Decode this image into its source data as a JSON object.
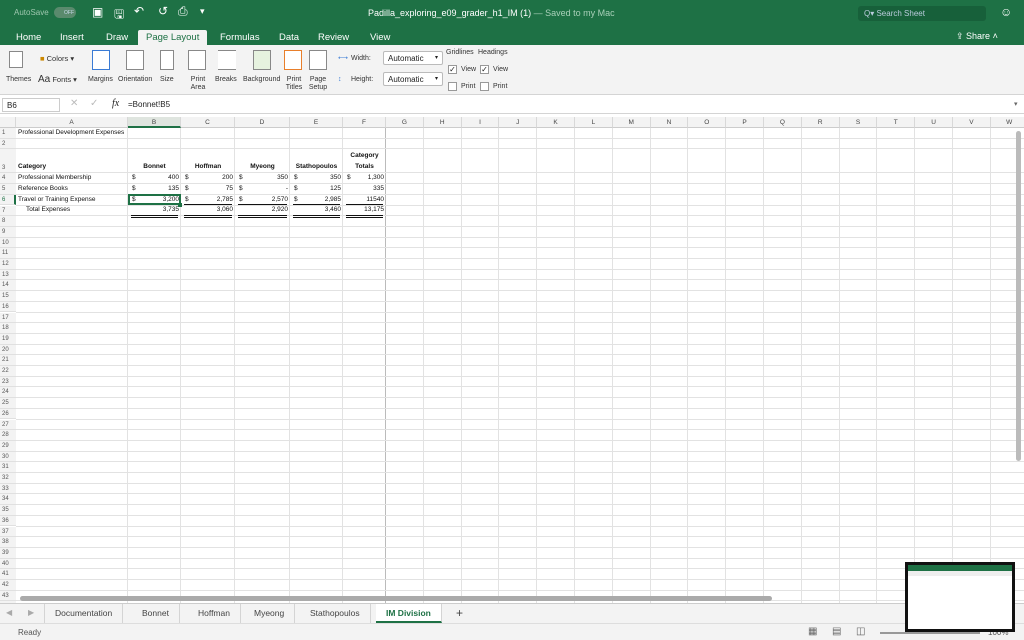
{
  "titlebar": {
    "autosave": "AutoSave",
    "autosave_state": "OFF",
    "title": "Padilla_exploring_e09_grader_h1_IM (1)",
    "saved": "— Saved to my Mac",
    "search_placeholder": "Search Sheet"
  },
  "ribbon_tabs": [
    "Home",
    "Insert",
    "Draw",
    "Page Layout",
    "Formulas",
    "Data",
    "Review",
    "View"
  ],
  "active_tab": "Page Layout",
  "share_label": "Share",
  "ribbon": {
    "themes": "Themes",
    "colors": "Colors",
    "fonts": "Fonts",
    "margins": "Margins",
    "orientation": "Orientation",
    "size": "Size",
    "print_area": "Print Area",
    "breaks": "Breaks",
    "background": "Background",
    "print_titles": "Print Titles",
    "page_setup": "Page Setup",
    "width_label": "Width:",
    "width_value": "Automatic",
    "height_label": "Height:",
    "height_value": "Automatic",
    "gridlines": "Gridlines",
    "headings": "Headings",
    "view": "View",
    "print": "Print",
    "gridlines_view": true,
    "gridlines_print": false,
    "headings_view": true,
    "headings_print": false
  },
  "formula_bar": {
    "name_box": "B6",
    "fx": "fx",
    "formula": "=Bonnet!B5"
  },
  "columns": [
    "A",
    "B",
    "C",
    "D",
    "E",
    "F",
    "G",
    "H",
    "I",
    "J",
    "K",
    "L",
    "M",
    "N",
    "O",
    "P",
    "Q",
    "R",
    "S",
    "T",
    "U",
    "V",
    "W"
  ],
  "cells": [
    {
      "r": 1,
      "c": "A",
      "v": "Professional Development Expenses"
    },
    {
      "r": 3,
      "c": "A",
      "v": "Category",
      "bold": true
    },
    {
      "r": 3,
      "c": "B",
      "v": "Bonnet",
      "bold": true,
      "align": "center"
    },
    {
      "r": 3,
      "c": "C",
      "v": "Hoffman",
      "bold": true,
      "align": "center"
    },
    {
      "r": 3,
      "c": "D",
      "v": "Myeong",
      "bold": true,
      "align": "center"
    },
    {
      "r": 3,
      "c": "E",
      "v": "Stathopoulos",
      "bold": true,
      "align": "center"
    },
    {
      "r": 3,
      "c": "F",
      "v": "Category",
      "bold": true,
      "align": "center",
      "line": "top"
    },
    {
      "r": 3,
      "c": "F",
      "v": "Totals",
      "bold": true,
      "align": "center"
    },
    {
      "r": 4,
      "c": "A",
      "v": "Professional Membership"
    },
    {
      "r": 4,
      "c": "B",
      "v": "400",
      "cur": "$"
    },
    {
      "r": 4,
      "c": "C",
      "v": "200",
      "cur": "$"
    },
    {
      "r": 4,
      "c": "D",
      "v": "350",
      "cur": "$"
    },
    {
      "r": 4,
      "c": "E",
      "v": "350",
      "cur": "$"
    },
    {
      "r": 4,
      "c": "F",
      "v": "1,300",
      "cur": "$"
    },
    {
      "r": 5,
      "c": "A",
      "v": "Reference Books"
    },
    {
      "r": 5,
      "c": "B",
      "v": "135",
      "cur": "$"
    },
    {
      "r": 5,
      "c": "C",
      "v": "75",
      "cur": "$"
    },
    {
      "r": 5,
      "c": "D",
      "v": "-",
      "cur": "$"
    },
    {
      "r": 5,
      "c": "E",
      "v": "125",
      "cur": "$"
    },
    {
      "r": 5,
      "c": "F",
      "v": "335"
    },
    {
      "r": 6,
      "c": "A",
      "v": "Travel or Training Expense"
    },
    {
      "r": 6,
      "c": "B",
      "v": "3,200",
      "cur": "$",
      "ul": 1
    },
    {
      "r": 6,
      "c": "C",
      "v": "2,785",
      "cur": "$",
      "ul": 1
    },
    {
      "r": 6,
      "c": "D",
      "v": "2,570",
      "cur": "$",
      "ul": 1
    },
    {
      "r": 6,
      "c": "E",
      "v": "2,985",
      "cur": "$",
      "ul": 1
    },
    {
      "r": 6,
      "c": "F",
      "v": "11540",
      "ul": 1
    },
    {
      "r": 7,
      "c": "A",
      "v": "Total Expenses",
      "indent": true
    },
    {
      "r": 7,
      "c": "B",
      "v": "3,735",
      "ul": 2
    },
    {
      "r": 7,
      "c": "C",
      "v": "3,060",
      "ul": 2
    },
    {
      "r": 7,
      "c": "D",
      "v": "2,920",
      "ul": 2
    },
    {
      "r": 7,
      "c": "E",
      "v": "3,460",
      "ul": 2
    },
    {
      "r": 7,
      "c": "F",
      "v": "13,175",
      "ul": 2
    }
  ],
  "selected_cell": "B6",
  "sheet_tabs": [
    "Documentation",
    "Bonnet",
    "Hoffman",
    "Myeong",
    "Stathopoulos",
    "IM Division"
  ],
  "active_sheet": "IM Division",
  "status": {
    "ready": "Ready",
    "zoom": "100%"
  },
  "colors": {
    "accent": "#1e7145"
  }
}
